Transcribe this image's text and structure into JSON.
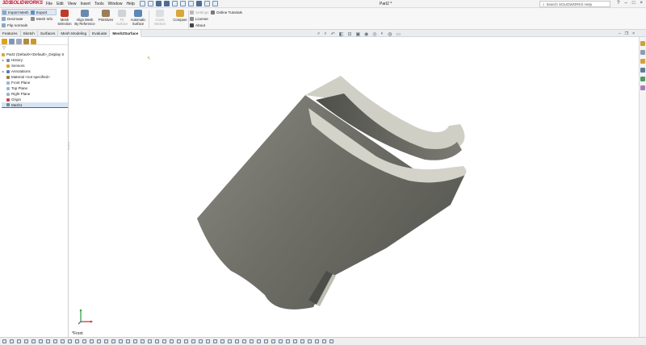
{
  "app": {
    "logo_prefix": "3DS",
    "logo_text": "SOLIDWORKS",
    "menu": [
      "File",
      "Edit",
      "View",
      "Insert",
      "Tools",
      "Window",
      "Help"
    ],
    "doc_title": "Part2 *",
    "search_placeholder": "Search SOLIDWORKS Help",
    "window_controls": [
      "?",
      "–",
      "□",
      "×"
    ]
  },
  "command_manager": {
    "left_items": [
      {
        "label": "Import Mesh",
        "icon": "import-mesh-icon"
      },
      {
        "label": "Decimate",
        "icon": "decimate-icon"
      },
      {
        "label": "Flip normals",
        "icon": "flip-normals-icon"
      }
    ],
    "mid_items": [
      {
        "label": "Export",
        "icon": "export-icon"
      },
      {
        "label": "Mesh Info",
        "icon": "mesh-info-icon"
      }
    ],
    "big_buttons": [
      {
        "label1": "Mesh",
        "label2": "Selection",
        "enabled": true
      },
      {
        "label1": "Align Mesh",
        "label2": "By Reference",
        "enabled": true
      },
      {
        "label1": "Primitives",
        "label2": "",
        "enabled": true
      },
      {
        "label1": "Fit",
        "label2": "Surface",
        "enabled": false
      },
      {
        "label1": "Automatic",
        "label2": "Surface",
        "enabled": true
      },
      {
        "label1": "Cross Section",
        "label2": "",
        "enabled": false
      },
      {
        "label1": "Compare",
        "label2": "",
        "enabled": true
      }
    ],
    "help_items": [
      {
        "label": "Settings",
        "enabled": false
      },
      {
        "label": "License",
        "enabled": true
      },
      {
        "label": "About",
        "enabled": true
      }
    ],
    "tutorials_label": "Online Tutorials"
  },
  "tabs": [
    "Features",
    "Sketch",
    "Surfaces",
    "Mesh Modeling",
    "Evaluate",
    "Mesh2Surface"
  ],
  "active_tab": "Mesh2Surface",
  "feature_tree": {
    "root": "Part2 (Default<<Default>_Display S",
    "items": [
      {
        "label": "History",
        "expand": "▸",
        "icon": "history-icon",
        "color": "#7a8ea8"
      },
      {
        "label": "Sensors",
        "expand": "",
        "icon": "sensors-icon",
        "color": "#e0a21b"
      },
      {
        "label": "Annotations",
        "expand": "▸",
        "icon": "annotations-icon",
        "color": "#5f7ea3"
      },
      {
        "label": "Material <not specified>",
        "expand": "",
        "icon": "material-icon",
        "color": "#9c7b4a"
      },
      {
        "label": "Front Plane",
        "expand": "",
        "icon": "plane-icon",
        "color": "#9bb6d3"
      },
      {
        "label": "Top Plane",
        "expand": "",
        "icon": "plane-icon",
        "color": "#9bb6d3"
      },
      {
        "label": "Right Plane",
        "expand": "",
        "icon": "plane-icon",
        "color": "#9bb6d3"
      },
      {
        "label": "Origin",
        "expand": "",
        "icon": "origin-icon",
        "color": "#c24a4a"
      },
      {
        "label": "Mesh1",
        "expand": "",
        "icon": "mesh-body-icon",
        "color": "#6b86a6"
      }
    ],
    "selected_item": "Mesh1"
  },
  "viewport": {
    "view_orientation": "*Front",
    "model_color": "#6d6d66",
    "edge_color": "#c9c9c0"
  }
}
